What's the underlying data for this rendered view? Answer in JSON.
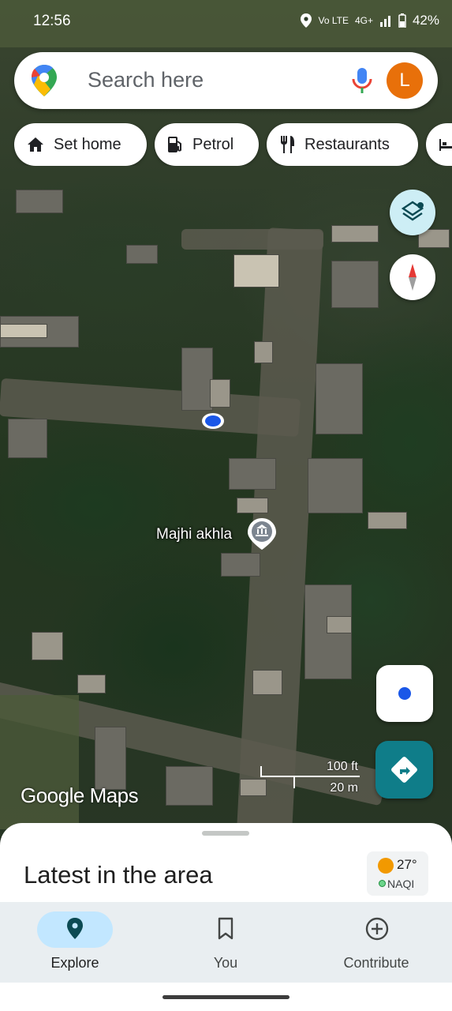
{
  "status_bar": {
    "time": "12:56",
    "network": "4G+",
    "volte": "Vo LTE",
    "battery": "42%"
  },
  "search": {
    "placeholder": "Search here",
    "avatar_letter": "L"
  },
  "chips": [
    {
      "label": "Set home",
      "icon": "home-icon"
    },
    {
      "label": "Petrol",
      "icon": "fuel-pump-icon"
    },
    {
      "label": "Restaurants",
      "icon": "fork-knife-icon"
    },
    {
      "label": "",
      "icon": "bed-icon"
    }
  ],
  "map": {
    "place_label": "Majhi akhla",
    "scale_ft": "100 ft",
    "scale_m": "20 m",
    "brand": "Google Maps"
  },
  "sheet": {
    "title": "Latest in the area",
    "weather_temp": "27°",
    "weather_aqi": "NAQI"
  },
  "nav": {
    "items": [
      {
        "label": "Explore",
        "active": true
      },
      {
        "label": "You",
        "active": false
      },
      {
        "label": "Contribute",
        "active": false
      }
    ]
  },
  "colors": {
    "accent": "#0f7d89",
    "avatar": "#e8700a",
    "nav_active_pill": "#c2e7ff",
    "location_dot": "#1a57e8"
  }
}
